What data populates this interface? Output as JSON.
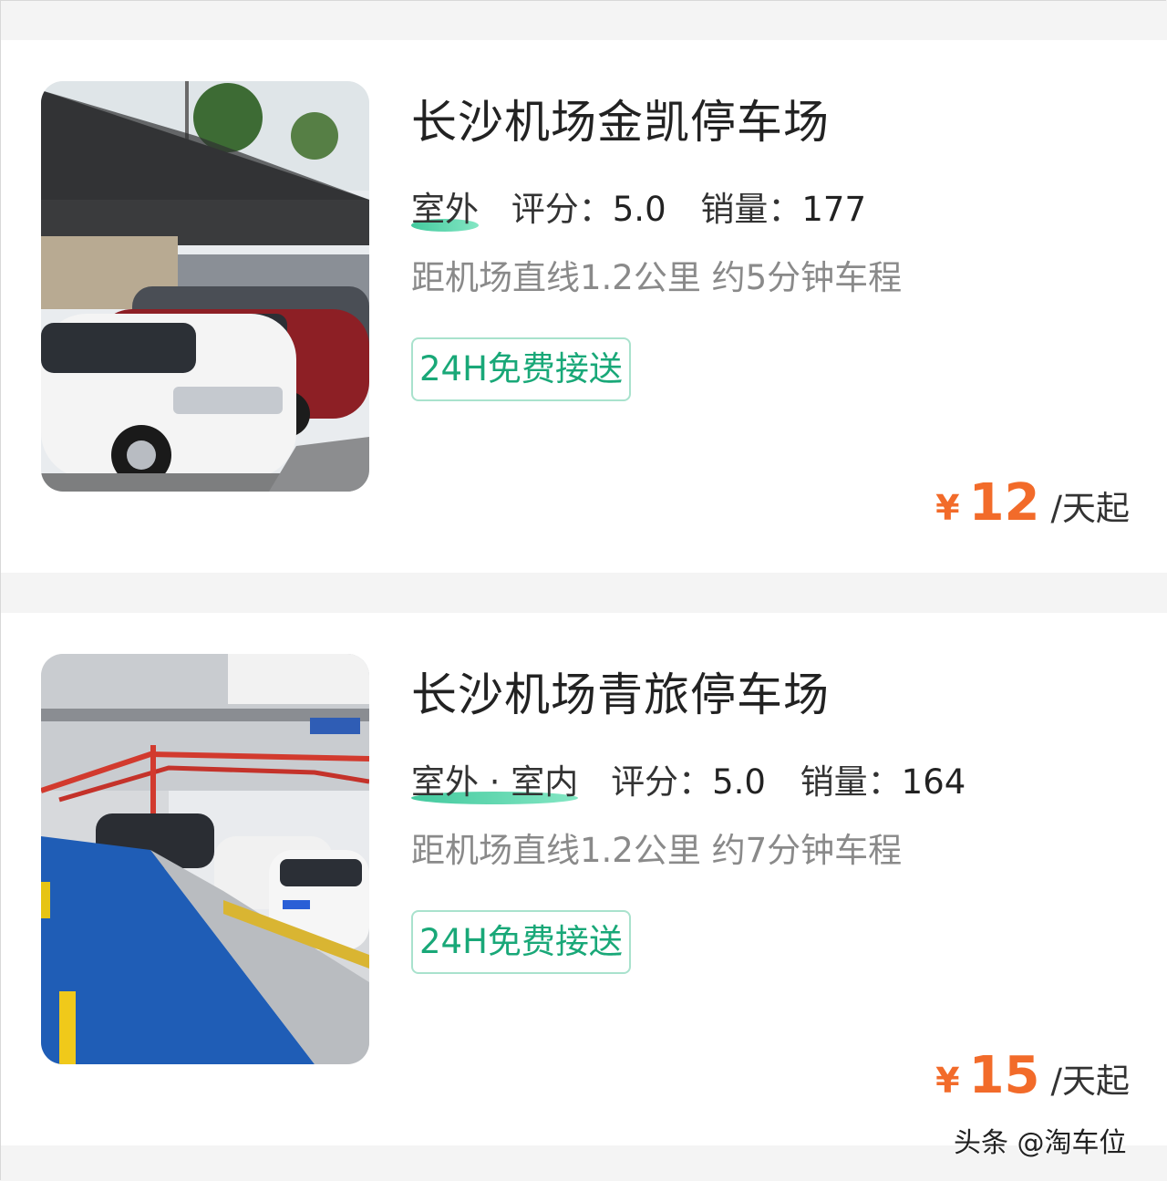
{
  "listings": [
    {
      "title": "长沙机场金凯停车场",
      "location_type": "室外",
      "rating_label": "评分：",
      "rating": "5.0",
      "sales_label": "销量：",
      "sales": "177",
      "distance": "距机场直线1.2公里 约5分钟车程",
      "tag": "24H免费接送",
      "currency": "¥",
      "price": "12",
      "price_unit": "/天起"
    },
    {
      "title": "长沙机场青旅停车场",
      "location_type": "室外 · 室内",
      "rating_label": "评分：",
      "rating": "5.0",
      "sales_label": "销量：",
      "sales": "164",
      "distance": "距机场直线1.2公里 约7分钟车程",
      "tag": "24H免费接送",
      "currency": "¥",
      "price": "15",
      "price_unit": "/天起"
    }
  ],
  "watermark": "头条 @淘车位",
  "colors": {
    "accent_green": "#19a878",
    "price_orange": "#f26b2a",
    "page_background": "#f4f4f4"
  }
}
